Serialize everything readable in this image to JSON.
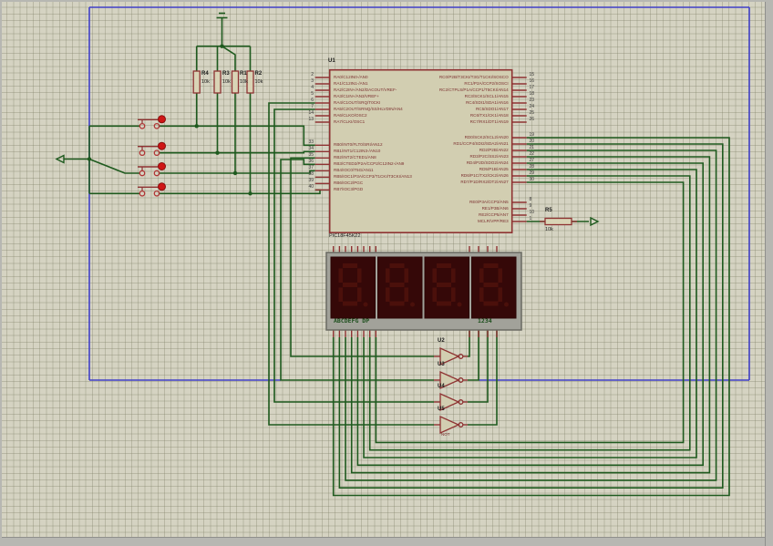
{
  "schematic": {
    "tool_hint": "circuit schematic canvas",
    "colors": {
      "wire": "#1e5a1e",
      "component": "#8e3232",
      "sheet_border": "#4040c8",
      "button_red": "#cf1616",
      "chip_fill": "#d2ceb1",
      "display_panel": "#350808",
      "display_frame": "#a2a29a",
      "ghost_segment": "#4b100b"
    }
  },
  "chip": {
    "ref": "U1",
    "part": "PIC18F45K22",
    "left_a": [
      {
        "num": "2",
        "label": "RA0/C12IN0-/AN0"
      },
      {
        "num": "3",
        "label": "RA1/C12IN1-/AN1"
      },
      {
        "num": "4",
        "label": "RA2/C2IN+/AN2/DACOUT/VREF-"
      },
      {
        "num": "5",
        "label": "RA3/C1IN+/AN3/VREF+"
      },
      {
        "num": "6",
        "label": "RA4/C1OUT/SRQ/T0CKI"
      },
      {
        "num": "7",
        "label": "RA5/C2OUT/SRNQ/SS/HLVDIN/AN4"
      },
      {
        "num": "14",
        "label": "RA6/CLKO/OSC2"
      },
      {
        "num": "13",
        "label": "RA7/CLKI/OSC1"
      }
    ],
    "left_b": [
      {
        "num": "33",
        "label": "RB0/INT0/FLT0/SRI/AN12"
      },
      {
        "num": "34",
        "label": "RB1/INT1/C12IN3-/AN10"
      },
      {
        "num": "35",
        "label": "RB2/INT2/CTED1/AN8"
      },
      {
        "num": "36",
        "label": "RB3/CTED2/P2A/CCP2/C12IN2-/AN9"
      },
      {
        "num": "37",
        "label": "RB4/IOC0/T5G/AN11"
      },
      {
        "num": "38",
        "label": "RB5/IOC1/P3A/CCP3/T1CKI/T3CKI/AN13"
      },
      {
        "num": "39",
        "label": "RB6/IOC2/PGC"
      },
      {
        "num": "40",
        "label": "RB7/IOC3/PGD"
      }
    ],
    "right_c": [
      {
        "num": "15",
        "label": "RC0/P2B/T3CKI/T3G/T1CKI/SOSCO"
      },
      {
        "num": "16",
        "label": "RC1/P2A/CCP2/SOSCI"
      },
      {
        "num": "17",
        "label": "RC2/CTPLS/P1A/CCP1/T5CKI/AN14"
      },
      {
        "num": "18",
        "label": "RC3/SCK1/SCL1/AN15"
      },
      {
        "num": "23",
        "label": "RC4/SDI1/SDA1/AN16"
      },
      {
        "num": "24",
        "label": "RC5/SDO1/AN17"
      },
      {
        "num": "25",
        "label": "RC6/TX1/CK1/AN18"
      },
      {
        "num": "26",
        "label": "RC7/RX1/DT1/AN19"
      }
    ],
    "right_d": [
      {
        "num": "19",
        "label": "RD0/SCK2/SCL2/AN20"
      },
      {
        "num": "20",
        "label": "RD1/CCP4/SDI2/SDA2/AN21"
      },
      {
        "num": "21",
        "label": "RD2/P2B/AN22"
      },
      {
        "num": "22",
        "label": "RD3/P2C/SS2/AN23"
      },
      {
        "num": "27",
        "label": "RD4/P2D/SDO2/AN24"
      },
      {
        "num": "28",
        "label": "RD5/P1B/AN25"
      },
      {
        "num": "29",
        "label": "RD6/P1C/TX2/CK2/AN26"
      },
      {
        "num": "30",
        "label": "RD7/P1D/RX2/DT2/AN27"
      }
    ],
    "right_e": [
      {
        "num": "8",
        "label": "RE0/P3A/CCP3/AN5"
      },
      {
        "num": "9",
        "label": "RE1/P3B/AN6"
      },
      {
        "num": "10",
        "label": "RE2/CCP5/AN7"
      },
      {
        "num": "1",
        "label": "MCLR/VPP/RE3"
      }
    ]
  },
  "resistors": [
    {
      "ref": "R4",
      "value": "10k"
    },
    {
      "ref": "R3",
      "value": "10k"
    },
    {
      "ref": "R1",
      "value": "10k"
    },
    {
      "ref": "R2",
      "value": "10k"
    },
    {
      "ref": "R5",
      "value": "10k"
    }
  ],
  "gates": {
    "type_label": "NOT",
    "refs": [
      "U2",
      "U3",
      "U4",
      "U5"
    ]
  },
  "display": {
    "segment_pins_label": "ABCDEFG DP",
    "digit_pins_label": "1234",
    "digits_shown": [
      "8.",
      "8.",
      "8.",
      "8."
    ]
  }
}
